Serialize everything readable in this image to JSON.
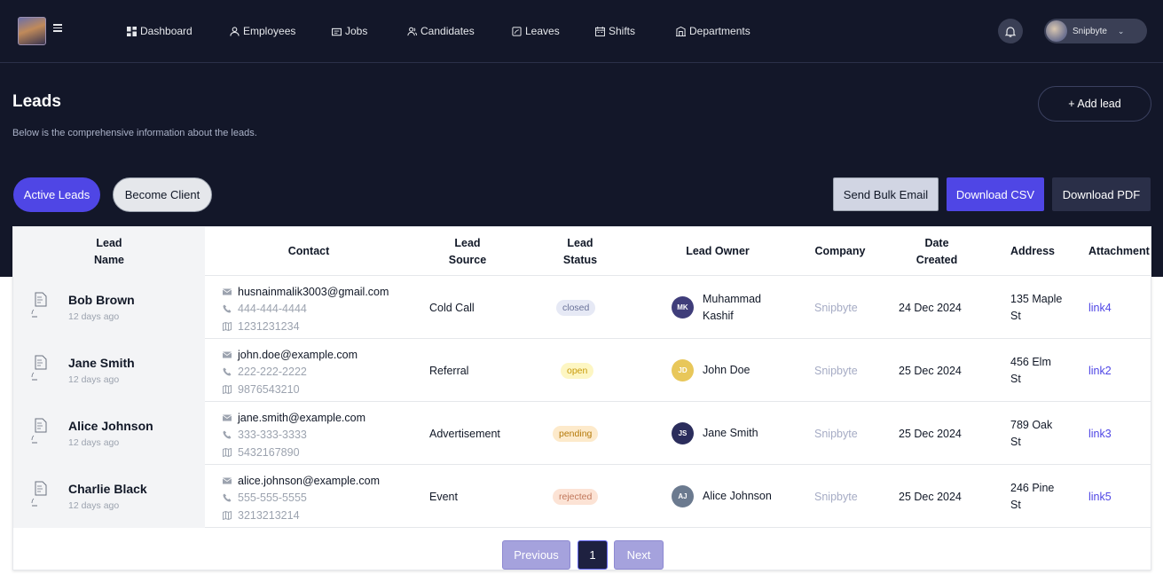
{
  "nav": {
    "items": [
      {
        "label": "Dashboard",
        "icon": "dashboard-icon"
      },
      {
        "label": "Employees",
        "icon": "user-icon"
      },
      {
        "label": "Jobs",
        "icon": "briefcase-icon"
      },
      {
        "label": "Candidates",
        "icon": "users-icon"
      },
      {
        "label": "Leaves",
        "icon": "leaf-icon"
      },
      {
        "label": "Shifts",
        "icon": "calendar-icon"
      },
      {
        "label": "Departments",
        "icon": "building-icon"
      }
    ]
  },
  "profile": {
    "name": "Snipbyte"
  },
  "header": {
    "title": "Leads",
    "subtitle": "Below is the comprehensive information about the leads.",
    "add_button": "+ Add lead"
  },
  "filters": {
    "active": "Active Leads",
    "client": "Become Client"
  },
  "actions": {
    "bulk_email": "Send Bulk Email",
    "csv": "Download CSV",
    "pdf": "Download PDF"
  },
  "table": {
    "headers": {
      "name_1": "Lead",
      "name_2": "Name",
      "contact": "Contact",
      "source_1": "Lead",
      "source_2": "Source",
      "status_1": "Lead",
      "status_2": "Status",
      "owner": "Lead Owner",
      "company": "Company",
      "date_1": "Date",
      "date_2": "Created",
      "address": "Address",
      "attachment": "Attachment"
    },
    "rows": [
      {
        "name": "Bob Brown",
        "age": "12 days ago",
        "email": "husnainmalik3003@gmail.com",
        "phone": "444-444-4444",
        "id": "1231231234",
        "source": "Cold Call",
        "status": "closed",
        "owner_initials": "MK",
        "owner": "Muhammad Kashif",
        "company": "Snipbyte",
        "date": "24 Dec 2024",
        "address": "135 Maple St",
        "attachment": "link4"
      },
      {
        "name": "Jane Smith",
        "age": "12 days ago",
        "email": "john.doe@example.com",
        "phone": "222-222-2222",
        "id": "9876543210",
        "source": "Referral",
        "status": "open",
        "owner_initials": "JD",
        "owner": "John Doe",
        "company": "Snipbyte",
        "date": "25 Dec 2024",
        "address": "456 Elm St",
        "attachment": "link2"
      },
      {
        "name": "Alice Johnson",
        "age": "12 days ago",
        "email": "jane.smith@example.com",
        "phone": "333-333-3333",
        "id": "5432167890",
        "source": "Advertisement",
        "status": "pending",
        "owner_initials": "JS",
        "owner": "Jane Smith",
        "company": "Snipbyte",
        "date": "25 Dec 2024",
        "address": "789 Oak St",
        "attachment": "link3"
      },
      {
        "name": "Charlie Black",
        "age": "12 days ago",
        "email": "alice.johnson@example.com",
        "phone": "555-555-5555",
        "id": "3213213214",
        "source": "Event",
        "status": "rejected",
        "owner_initials": "AJ",
        "owner": "Alice Johnson",
        "company": "Snipbyte",
        "date": "25 Dec 2024",
        "address": "246 Pine St",
        "attachment": "link5"
      }
    ]
  },
  "pagination": {
    "prev": "Previous",
    "page": "1",
    "next": "Next"
  },
  "colors": {
    "accent": "#4f46e5",
    "hero_bg": "#131729",
    "owner_mk": "#3f3d7a",
    "owner_jd": "#e8c75a",
    "owner_js": "#2b2d5c",
    "owner_aj": "#6b7a8f"
  }
}
